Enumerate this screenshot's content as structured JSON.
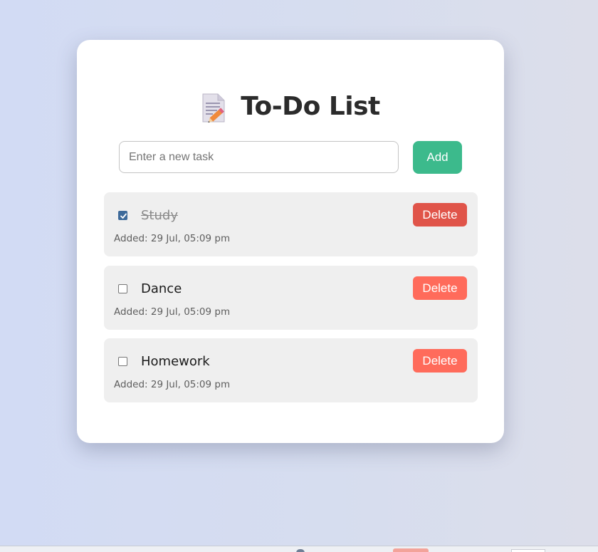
{
  "app": {
    "title": "To-Do List",
    "title_icon": "memo-icon"
  },
  "new_task": {
    "placeholder": "Enter a new task",
    "value": "",
    "add_label": "Add"
  },
  "tasks": [
    {
      "name": "Study",
      "completed": true,
      "added": "Added: 29 Jul, 05:09 pm",
      "delete_label": "Delete"
    },
    {
      "name": "Dance",
      "completed": false,
      "added": "Added: 29 Jul, 05:09 pm",
      "delete_label": "Delete"
    },
    {
      "name": "Homework",
      "completed": false,
      "added": "Added: 29 Jul, 05:09 pm",
      "delete_label": "Delete"
    }
  ],
  "colors": {
    "add_button": "#3cba8c",
    "delete_button": "#ff6b5b",
    "delete_button_hover": "#e05449",
    "task_background": "#efefef",
    "checkbox_checked": "#3e6a9a"
  }
}
